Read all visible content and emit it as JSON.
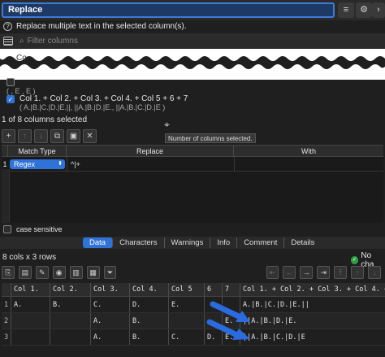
{
  "window": {
    "title": "Replace",
    "description": "Replace multiple text in the selected column(s).",
    "filter_placeholder": "Filter columns"
  },
  "column_list": {
    "truncated_label": "Co",
    "items": [
      {
        "label": "",
        "sub": "( , E , E )",
        "checked": false
      },
      {
        "label": "Col 1. + Col 2. + Col 3. + Col 4. + Col 5 + 6 + 7",
        "sub": "( A.|B.|C.|D.|E.||, ||A.|B.|D.|E., ||A.|B.|C.|D.|E )",
        "checked": true
      }
    ],
    "count_text": "1 of 8 columns selected"
  },
  "tooltip": "Number of columns selected.",
  "replace_table": {
    "headers": [
      "Match Type",
      "Replace",
      "With"
    ],
    "rows": [
      {
        "num": "1",
        "match_type": "Regex",
        "replace": "^|+",
        "with": ""
      }
    ]
  },
  "case_sensitive_label": "case sensitive",
  "tabs": [
    "Data",
    "Characters",
    "Warnings",
    "Info",
    "Comment",
    "Details"
  ],
  "active_tab": "Data",
  "info": {
    "size": "8 cols x 3 rows",
    "status": "No cha"
  },
  "grid": {
    "headers": [
      "Col 1.",
      "Col 2.",
      "Col 3.",
      "Col 4.",
      "Col 5",
      "6",
      "7",
      "Col 1. + Col 2. + Col 3. + Col 4. + Col 5 + 6 + 7"
    ],
    "rows": [
      {
        "num": "1",
        "cells": [
          "A.",
          "B.",
          "C.",
          "D.",
          "E.",
          "",
          "",
          "A.|B.|C.|D.|E.||"
        ]
      },
      {
        "num": "2",
        "cells": [
          "",
          "",
          "A.",
          "B.",
          "",
          "",
          "E.",
          "||A.|B.|D.|E."
        ]
      },
      {
        "num": "3",
        "cells": [
          "",
          "",
          "A.",
          "B.",
          "C.",
          "D.",
          "E.",
          "||A.|B.|C.|D.|E"
        ]
      }
    ]
  },
  "colors": {
    "accent": "#2f73d9",
    "arrow": "#2a6be0",
    "success": "#2ea043"
  }
}
